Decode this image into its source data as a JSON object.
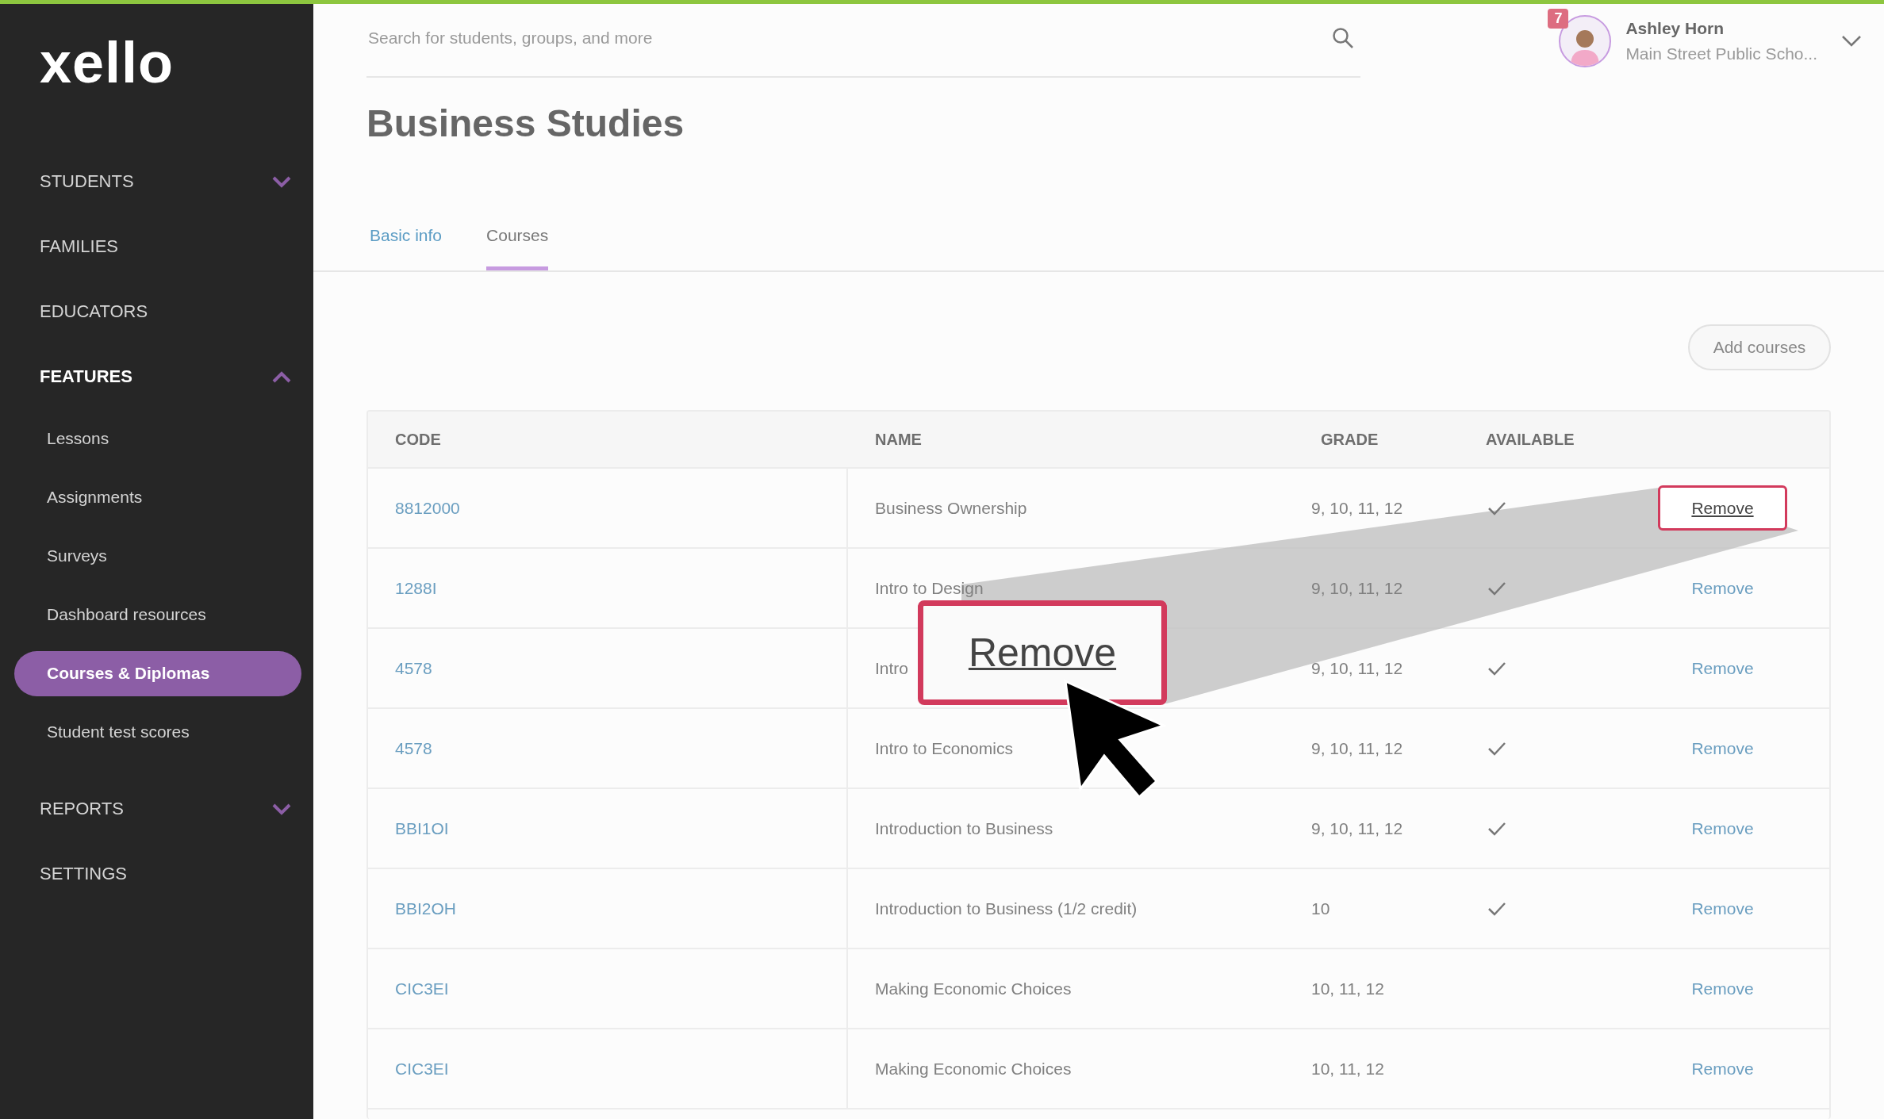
{
  "sidebar": {
    "logo": "xello",
    "items": [
      {
        "kind": "group",
        "label": "STUDENTS",
        "expanded": false,
        "selected": false
      },
      {
        "kind": "link",
        "label": "FAMILIES",
        "selected": false
      },
      {
        "kind": "link",
        "label": "EDUCATORS",
        "selected": false
      },
      {
        "kind": "group",
        "label": "FEATURES",
        "expanded": true,
        "selected": true,
        "children": [
          {
            "label": "Lessons",
            "selected": false
          },
          {
            "label": "Assignments",
            "selected": false
          },
          {
            "label": "Surveys",
            "selected": false
          },
          {
            "label": "Dashboard resources",
            "selected": false
          },
          {
            "label": "Courses & Diplomas",
            "selected": true
          },
          {
            "label": "Student test scores",
            "selected": false
          }
        ]
      },
      {
        "kind": "group",
        "label": "REPORTS",
        "expanded": false,
        "selected": false
      },
      {
        "kind": "link",
        "label": "SETTINGS",
        "selected": false
      }
    ]
  },
  "search": {
    "placeholder": "Search for students, groups, and more"
  },
  "user": {
    "name": "Ashley Horn",
    "school": "Main Street Public Scho...",
    "notifications": "7"
  },
  "title": "Business Studies",
  "tabs": [
    {
      "label": "Basic info",
      "selected": false
    },
    {
      "label": "Courses",
      "selected": true
    }
  ],
  "add_button": "Add courses",
  "table": {
    "columns": [
      "CODE",
      "NAME",
      "GRADE",
      "AVAILABLE"
    ],
    "rows": [
      {
        "code": "8812000",
        "name": "Business Ownership",
        "grade": "9, 10, 11, 12",
        "available": true,
        "action": "Remove",
        "highlighted": true
      },
      {
        "code": "1288I",
        "name": "Intro to Design",
        "grade": "9, 10, 11, 12",
        "available": true,
        "action": "Remove",
        "highlighted": false
      },
      {
        "code": "4578",
        "name": "Intro",
        "grade": "9, 10, 11, 12",
        "available": true,
        "action": "Remove",
        "highlighted": false
      },
      {
        "code": "4578",
        "name": "Intro to Economics",
        "grade": "9, 10, 11, 12",
        "available": true,
        "action": "Remove",
        "highlighted": false
      },
      {
        "code": "BBI1OI",
        "name": "Introduction to Business",
        "grade": "9, 10, 11, 12",
        "available": true,
        "action": "Remove",
        "highlighted": false
      },
      {
        "code": "BBI2OH",
        "name": "Introduction to Business (1/2 credit)",
        "grade": "10",
        "available": true,
        "action": "Remove",
        "highlighted": false
      },
      {
        "code": "CIC3EI",
        "name": "Making Economic Choices",
        "grade": "10, 11, 12",
        "available": false,
        "action": "Remove",
        "highlighted": false
      },
      {
        "code": "CIC3EI",
        "name": "Making Economic Choices",
        "grade": "10, 11, 12",
        "available": false,
        "action": "Remove",
        "highlighted": false
      }
    ]
  },
  "callout": {
    "text": "Remove"
  }
}
